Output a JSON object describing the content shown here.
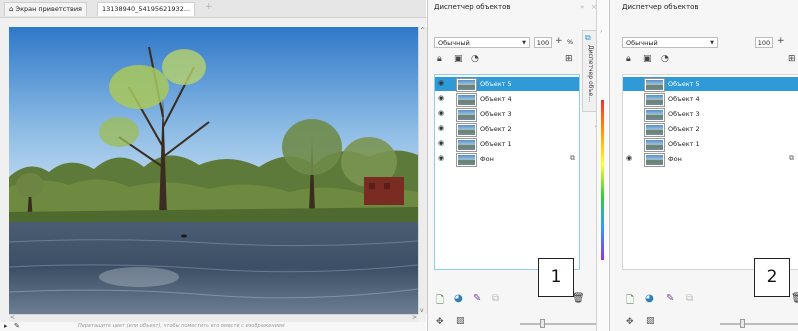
{
  "document": {
    "tabs": [
      "Экран приветствия",
      "13138940_54195621932..."
    ],
    "new_tab": "+",
    "status_hint": "Перетащите цвет (или объект), чтобы поместить его вместе с изображением",
    "status_icons": [
      "pointer-icon",
      "pen-icon"
    ]
  },
  "panel1": {
    "title": "Диспетчер объектов",
    "vertical_tab": "Диспетчер объе...",
    "mode": "Обычный",
    "opacity": "100",
    "opacity_unit": "%",
    "layers": [
      {
        "name": "Объект 5",
        "selected": true,
        "eye": true
      },
      {
        "name": "Объект 4",
        "selected": false,
        "eye": true
      },
      {
        "name": "Объект 3",
        "selected": false,
        "eye": true
      },
      {
        "name": "Объект 2",
        "selected": false,
        "eye": true
      },
      {
        "name": "Объект 1",
        "selected": false,
        "eye": true
      },
      {
        "name": "Фон",
        "selected": false,
        "eye": true,
        "locked": true
      }
    ],
    "marker": "1"
  },
  "panel2": {
    "title": "Диспетчер объектов",
    "mode": "Обычный",
    "opacity": "100",
    "layers": [
      {
        "name": "Объект 5",
        "selected": true,
        "eye": false
      },
      {
        "name": "Объект 4",
        "selected": false,
        "eye": false
      },
      {
        "name": "Объект 3",
        "selected": false,
        "eye": false
      },
      {
        "name": "Объект 2",
        "selected": false,
        "eye": false
      },
      {
        "name": "Объект 1",
        "selected": false,
        "eye": false
      },
      {
        "name": "Фон",
        "selected": false,
        "eye": true,
        "locked": true
      }
    ],
    "marker": "2"
  },
  "colors": {
    "selection": "#2e9ad8",
    "list_border": "#8fd0ea"
  }
}
